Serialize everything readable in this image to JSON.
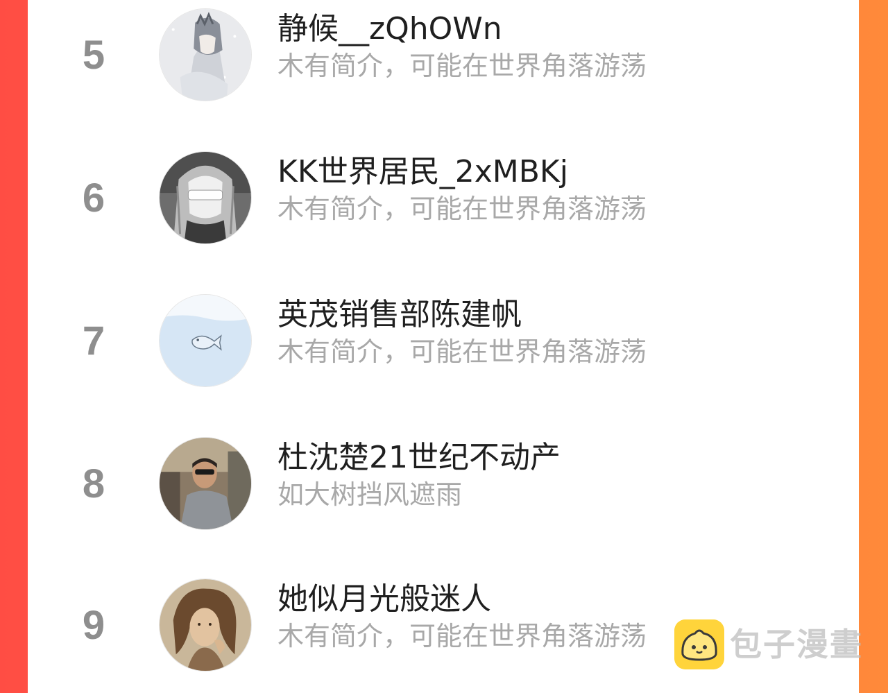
{
  "list": [
    {
      "rank": "5",
      "name": "静候__zQhOWn",
      "bio": "木有简介，可能在世界角落游荡",
      "avatar_icon": "anime-hooded-figure-avatar"
    },
    {
      "rank": "6",
      "name": "KK世界居民_2xMBKj",
      "bio": "木有简介，可能在世界角落游荡",
      "avatar_icon": "anime-blindfolded-girl-avatar"
    },
    {
      "rank": "7",
      "name": "英茂销售部陈建帆",
      "bio": "木有简介，可能在世界角落游荡",
      "avatar_icon": "fish-in-water-avatar"
    },
    {
      "rank": "8",
      "name": "杜沈楚21世纪不动产",
      "bio": "如大树挡风遮雨",
      "avatar_icon": "man-sunglasses-photo-avatar"
    },
    {
      "rank": "9",
      "name": "她似月光般迷人",
      "bio": "木有简介，可能在世界角落游荡",
      "avatar_icon": "woman-vintage-photo-avatar"
    }
  ],
  "watermark": {
    "text": "包子漫畫",
    "logo_icon": "bun-mascot-logo-icon"
  },
  "colors": {
    "background_left": "#ff4d44",
    "background_right": "#ff8a3a",
    "card": "#ffffff",
    "rank": "#8e8e8e",
    "name": "#1f1f1f",
    "bio": "#a8a8a8",
    "logo": "#ffd43b"
  }
}
